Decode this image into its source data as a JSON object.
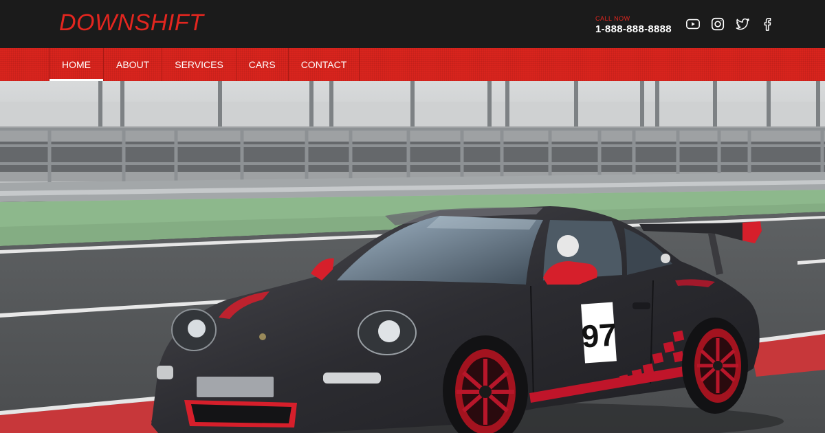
{
  "brand": {
    "logo_text": "DOWNSHIFT"
  },
  "contact": {
    "label": "CALL NOW",
    "phone": "1-888-888-8888"
  },
  "socials": [
    "youtube-icon",
    "instagram-icon",
    "twitter-icon",
    "facebook-icon"
  ],
  "nav": {
    "items": [
      {
        "label": "HOME",
        "active": true
      },
      {
        "label": "ABOUT",
        "active": false
      },
      {
        "label": "SERVICES",
        "active": false
      },
      {
        "label": "CARS",
        "active": false
      },
      {
        "label": "CONTACT",
        "active": false
      }
    ]
  },
  "hero": {
    "car_number": "97"
  },
  "colors": {
    "accent": "#d9241d",
    "header_bg": "#1b1b1b",
    "logo": "#e3261f"
  }
}
